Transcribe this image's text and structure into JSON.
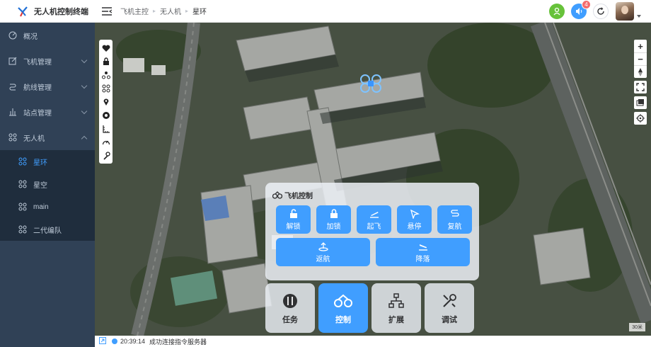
{
  "app": {
    "title": "无人机控制终端"
  },
  "sidebar": {
    "items": [
      {
        "label": "概况",
        "icon": "dashboard-icon",
        "expandable": false
      },
      {
        "label": "飞机管理",
        "icon": "edit-icon",
        "expandable": true
      },
      {
        "label": "航线管理",
        "icon": "route-icon",
        "expandable": true
      },
      {
        "label": "站点管理",
        "icon": "station-icon",
        "expandable": true
      },
      {
        "label": "无人机",
        "icon": "drone-icon",
        "expandable": true,
        "expanded": true
      }
    ],
    "sub_items": [
      {
        "label": "星环",
        "active": true
      },
      {
        "label": "星空",
        "active": false
      },
      {
        "label": "main",
        "active": false
      },
      {
        "label": "二代编队",
        "active": false
      }
    ]
  },
  "header": {
    "breadcrumb": [
      "飞机主控",
      "无人机",
      "星环"
    ],
    "notification_count": "4",
    "colors": {
      "green": "#67c23a",
      "blue": "#409eff",
      "badge": "#f56c6c"
    }
  },
  "map": {
    "scale_label": "30米",
    "zoom_in": "+",
    "zoom_out": "−"
  },
  "control_panel": {
    "title": "飞机控制",
    "row1": [
      {
        "label": "解锁",
        "icon": "unlock-icon"
      },
      {
        "label": "加锁",
        "icon": "lock-icon"
      },
      {
        "label": "起飞",
        "icon": "takeoff-icon"
      },
      {
        "label": "悬停",
        "icon": "hover-icon"
      },
      {
        "label": "复航",
        "icon": "resume-icon"
      }
    ],
    "row2": [
      {
        "label": "返航",
        "icon": "return-home-icon"
      },
      {
        "label": "降落",
        "icon": "landing-icon"
      }
    ]
  },
  "tabs": [
    {
      "label": "任务",
      "icon": "task-icon",
      "active": false
    },
    {
      "label": "控制",
      "icon": "control-icon",
      "active": true
    },
    {
      "label": "扩展",
      "icon": "extend-icon",
      "active": false
    },
    {
      "label": "调试",
      "icon": "debug-icon",
      "active": false
    }
  ],
  "status": {
    "time": "20:39:14",
    "message": "成功连接指令服务器"
  }
}
